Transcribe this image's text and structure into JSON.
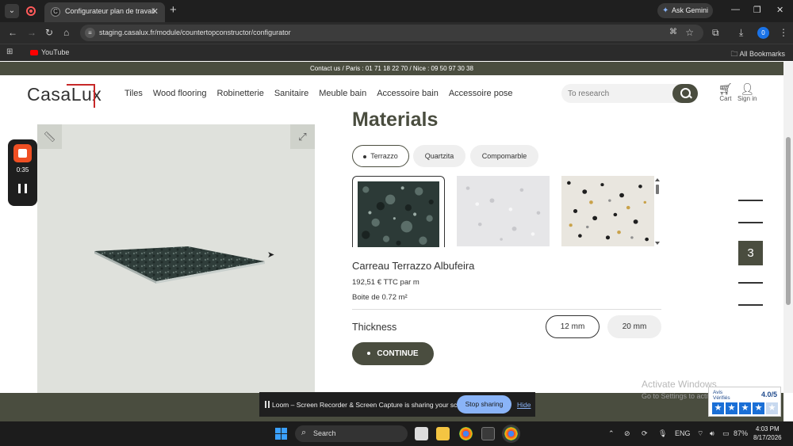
{
  "browser": {
    "tab_title": "Configurateur plan de travail",
    "ask_gemini": "Ask Gemini",
    "url": "staging.casalux.fr/module/countertopconstructor/configurator",
    "profile_initial": "0",
    "bookmark_youtube": "YouTube",
    "all_bookmarks": "All Bookmarks"
  },
  "site": {
    "contact_bar": "Contact us / Paris : 01 71 18 22 70 / Nice : 09 50 97 30 38",
    "logo_text": "CasaLux",
    "nav": [
      "Tiles",
      "Wood flooring",
      "Robinetterie",
      "Sanitaire",
      "Meuble bain",
      "Accessoire bain",
      "Accessoire pose"
    ],
    "search_placeholder": "To research",
    "cart_label": "Cart",
    "signin_label": "Sign in",
    "brand_color": "#4a4d3f"
  },
  "configurator": {
    "title": "Materials",
    "material_tabs": [
      "Terrazzo",
      "Quartzita",
      "Compomarble"
    ],
    "active_tab": "Terrazzo",
    "product_name": "Carreau Terrazzo Albufeira",
    "price": "192,51 € TTC par m",
    "box": "Boite de 0.72 m²",
    "thickness_label": "Thickness",
    "thickness_options": [
      "12 mm",
      "20 mm"
    ],
    "selected_thickness": "12 mm",
    "continue_label": "CONTINUE",
    "current_step": "3"
  },
  "loom": {
    "timer": "0:35",
    "sharing_message": "Loom – Screen Recorder & Screen Capture is sharing your screen.",
    "stop_sharing": "Stop sharing",
    "hide": "Hide"
  },
  "windows": {
    "activate_title": "Activate Windows",
    "activate_sub": "Go to Settings to activate Windows.",
    "search": "Search",
    "lang": "ENG",
    "battery": "87%",
    "time": "4:03 PM",
    "date": "8/17/2026"
  },
  "avis": {
    "brand_line1": "Avis",
    "brand_line2": "Vérifiés",
    "score": "4.0/5"
  }
}
